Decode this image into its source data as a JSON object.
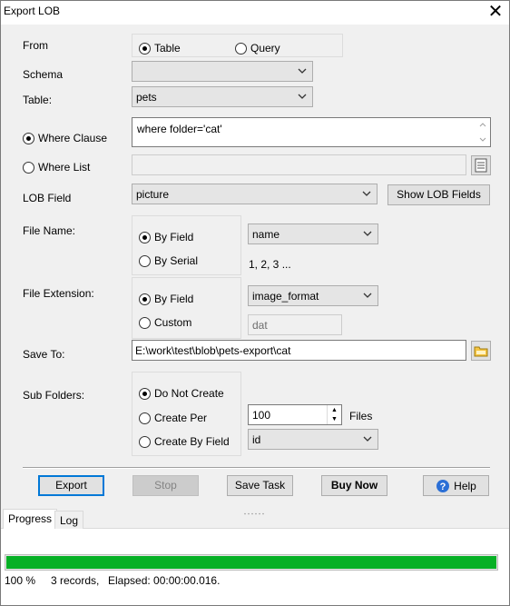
{
  "window": {
    "title": "Export LOB"
  },
  "form": {
    "from_label": "From",
    "from_table": "Table",
    "from_query": "Query",
    "schema_label": "Schema",
    "schema_value": "",
    "table_label": "Table:",
    "table_value": "pets",
    "where_clause_label": "Where Clause",
    "where_clause_value": "where folder='cat'",
    "where_list_label": "Where List",
    "where_list_value": "",
    "lob_field_label": "LOB Field",
    "lob_field_value": "picture",
    "show_lob_fields": "Show LOB Fields",
    "file_name_label": "File Name:",
    "by_field": "By Field",
    "by_serial": "By Serial",
    "file_name_field_value": "name",
    "serial_hint": "1, 2, 3 ...",
    "file_ext_label": "File Extension:",
    "ext_by_field": "By Field",
    "ext_custom": "Custom",
    "ext_field_value": "image_format",
    "ext_custom_value": "dat",
    "save_to_label": "Save To:",
    "save_to_value": "E:\\work\\test\\blob\\pets-export\\cat",
    "sub_folders_label": "Sub Folders:",
    "do_not_create": "Do Not Create",
    "create_per": "Create Per",
    "create_by_field": "Create By Field",
    "per_count_value": "100",
    "files_label": "Files",
    "by_field_value": "id"
  },
  "buttons": {
    "export": "Export",
    "stop": "Stop",
    "save_task": "Save Task",
    "buy_now": "Buy Now",
    "help": "Help"
  },
  "tabs": {
    "progress": "Progress",
    "log": "Log"
  },
  "status": {
    "progress_fraction": 1.0,
    "percent": "100 %",
    "records": "3 records,",
    "elapsed": "Elapsed: 00:00:00.016."
  },
  "colors": {
    "accent": "#0078d7",
    "progress": "#06b025",
    "help_icon": "#2b6fd6"
  }
}
